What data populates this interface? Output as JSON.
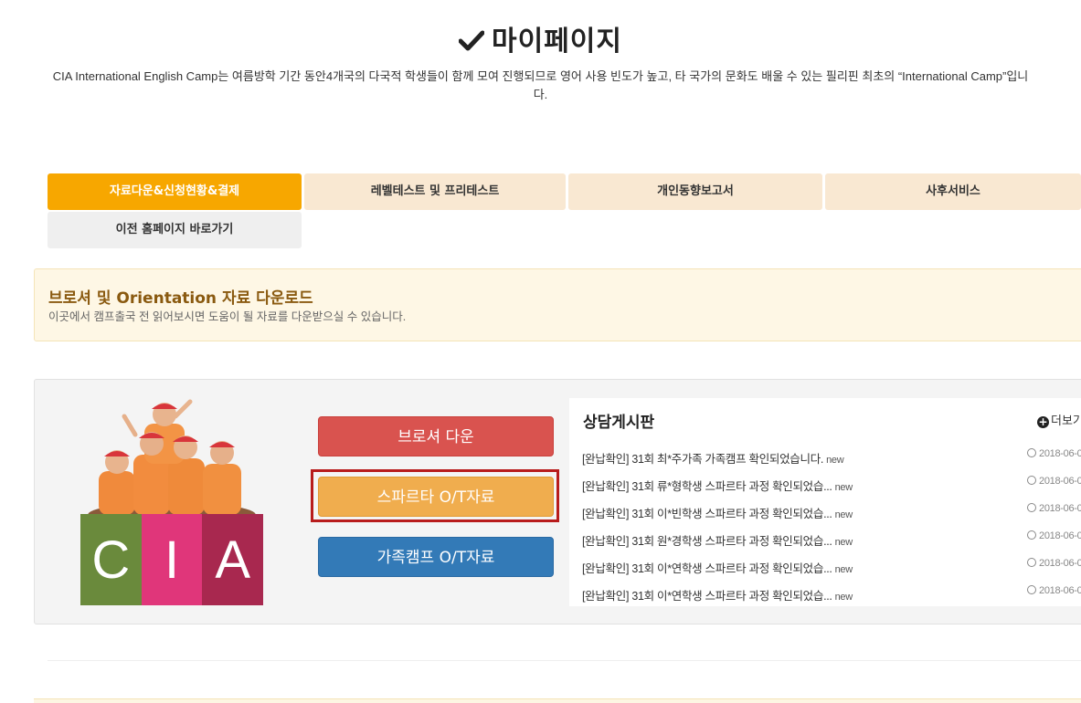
{
  "header": {
    "title": "마이페이지",
    "subtitle": "CIA International English Camp는 여름방학 기간 동안4개국의 다국적 학생들이 함께 모여 진행되므로 영어 사용 빈도가 높고, 타 국가의 문화도 배울 수 있는 필리핀 최초의 “International Camp”입니다."
  },
  "tabs": [
    {
      "label": "자료다운&신청현황&결제"
    },
    {
      "label": "레벨테스트 및 프리테스트"
    },
    {
      "label": "개인동향보고서"
    },
    {
      "label": "사후서비스"
    },
    {
      "label": "이전 홈페이지 바로가기"
    }
  ],
  "notice": {
    "title": "브로셔 및 Orientation 자료 다운로드",
    "description": "이곳에서 캠프출국 전 읽어보시면 도움이 될 자료를 다운받으실 수 있습니다."
  },
  "logo": {
    "letters": [
      "C",
      "I",
      "A"
    ],
    "colors": [
      "#6a8a3c",
      "#e0367a",
      "#a8284f"
    ],
    "hat_text": "CIA"
  },
  "buttons": {
    "brochure": "브로셔 다운",
    "sparta": "스파르타 O/T자료",
    "family": "가족캠프 O/T자료"
  },
  "board": {
    "title": "상담게시판",
    "more": "더보기",
    "items": [
      {
        "text": "[완납확인] 31회 최*주가족 가족캠프 확인되었습니다.",
        "badge": "new",
        "date": "2018-06-0"
      },
      {
        "text": "[완납확인] 31회 류*형학생 스파르타 과정 확인되었습...",
        "badge": "new",
        "date": "2018-06-0"
      },
      {
        "text": "[완납확인] 31회 이*빈학생 스파르타 과정 확인되었습...",
        "badge": "new",
        "date": "2018-06-0"
      },
      {
        "text": "[완납확인] 31회 원*경학생 스파르타 과정 확인되었습...",
        "badge": "new",
        "date": "2018-06-0"
      },
      {
        "text": "[완납확인] 31회 이*연학생 스파르타 과정 확인되었습...",
        "badge": "new",
        "date": "2018-06-0"
      },
      {
        "text": "[완납확인] 31회 이*연학생 스파르타 과정 확인되었습...",
        "badge": "new",
        "date": "2018-06-0"
      }
    ]
  },
  "colors": {
    "tab_active": "#f7a700",
    "tab_inactive": "#f9e8d2",
    "btn_red": "#d9534f",
    "btn_orange": "#f0ad4e",
    "btn_blue": "#337ab7",
    "highlight": "#b81c1c"
  }
}
